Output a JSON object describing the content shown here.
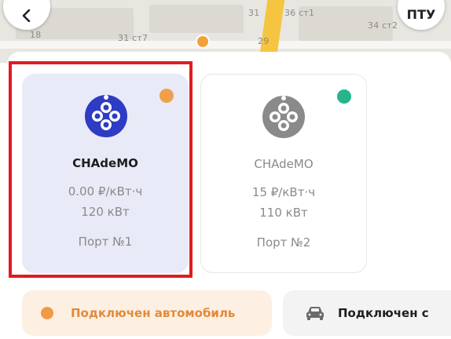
{
  "map": {
    "labels": [
      "18",
      "31 ст7",
      "31",
      "36 ст1",
      "34 ст2",
      "29"
    ]
  },
  "topbar": {
    "back_icon": "chevron-left-icon",
    "right_button_label": "ПТУ"
  },
  "connectors": [
    {
      "name": "CHAdeMO",
      "price": "0.00 ₽/кВт·ч",
      "power": "120 кВт",
      "port": "Порт №1",
      "status_color": "#F0A04B",
      "icon_color": "#2E3BC4",
      "selected": true
    },
    {
      "name": "CHAdeMO",
      "price": "15 ₽/кВт·ч",
      "power": "110 кВт",
      "port": "Порт №2",
      "status_color": "#27B48C",
      "icon_color": "#8A8A8A",
      "selected": false
    }
  ],
  "status_chips": [
    {
      "label": "Подключен автомобиль",
      "icon": "status-dot-icon",
      "color": "#EF9A45"
    },
    {
      "label": "Подключен с",
      "icon": "car-icon"
    }
  ],
  "colors": {
    "selection_border": "#E11B22",
    "selected_card_bg": "#E9EAF7"
  }
}
